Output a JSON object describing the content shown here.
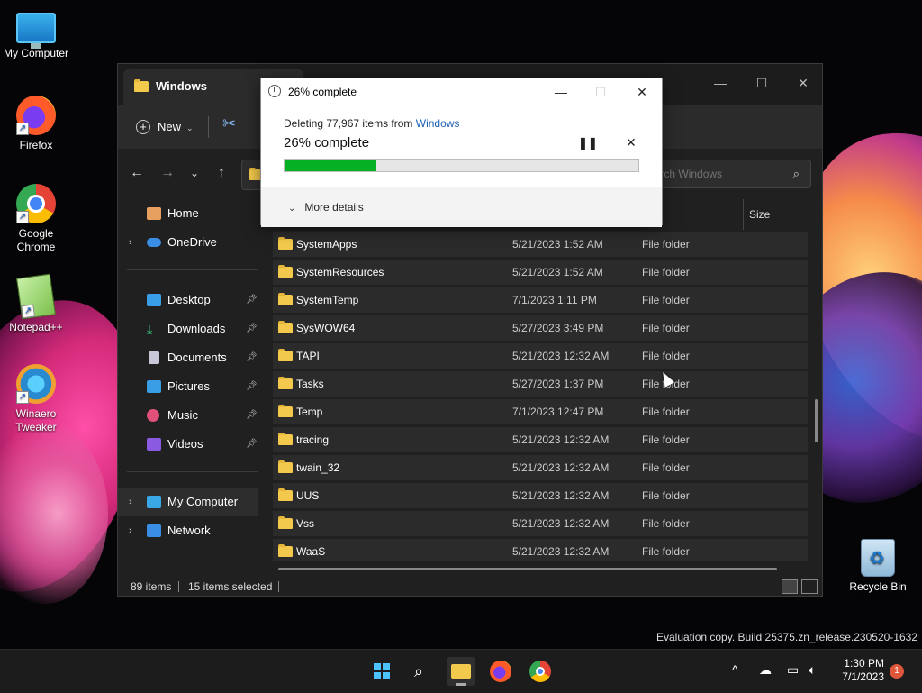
{
  "desktop": {
    "icons": [
      {
        "label": "My Computer"
      },
      {
        "label": "Firefox"
      },
      {
        "label": "Google Chrome"
      },
      {
        "label": "Notepad++"
      },
      {
        "label": "Winaero Tweaker"
      },
      {
        "label": "Recycle Bin"
      }
    ],
    "watermark": "Evaluation copy. Build 25375.zn_release.230520-1632"
  },
  "explorer": {
    "tab_title": "Windows",
    "toolbar": {
      "new_label": "New"
    },
    "search_placeholder": "Search Windows",
    "column_header_size": "Size",
    "sidebar": {
      "items": [
        {
          "label": "Home",
          "icon": "home-icon"
        },
        {
          "label": "OneDrive",
          "icon": "onedrive-icon"
        },
        {
          "label": "Desktop",
          "icon": "desktop-icon"
        },
        {
          "label": "Downloads",
          "icon": "downloads-icon"
        },
        {
          "label": "Documents",
          "icon": "documents-icon"
        },
        {
          "label": "Pictures",
          "icon": "pictures-icon"
        },
        {
          "label": "Music",
          "icon": "music-icon"
        },
        {
          "label": "Videos",
          "icon": "videos-icon"
        },
        {
          "label": "My Computer",
          "icon": "computer-icon"
        },
        {
          "label": "Network",
          "icon": "network-icon"
        }
      ]
    },
    "files": [
      {
        "name": "SystemApps",
        "date": "5/21/2023 1:52 AM",
        "type": "File folder"
      },
      {
        "name": "SystemResources",
        "date": "5/21/2023 1:52 AM",
        "type": "File folder"
      },
      {
        "name": "SystemTemp",
        "date": "7/1/2023 1:11 PM",
        "type": "File folder"
      },
      {
        "name": "SysWOW64",
        "date": "5/27/2023 3:49 PM",
        "type": "File folder"
      },
      {
        "name": "TAPI",
        "date": "5/21/2023 12:32 AM",
        "type": "File folder"
      },
      {
        "name": "Tasks",
        "date": "5/27/2023 1:37 PM",
        "type": "File folder"
      },
      {
        "name": "Temp",
        "date": "7/1/2023 12:47 PM",
        "type": "File folder"
      },
      {
        "name": "tracing",
        "date": "5/21/2023 12:32 AM",
        "type": "File folder"
      },
      {
        "name": "twain_32",
        "date": "5/21/2023 12:32 AM",
        "type": "File folder"
      },
      {
        "name": "UUS",
        "date": "5/21/2023 12:32 AM",
        "type": "File folder"
      },
      {
        "name": "Vss",
        "date": "5/21/2023 12:32 AM",
        "type": "File folder"
      },
      {
        "name": "WaaS",
        "date": "5/21/2023 12:32 AM",
        "type": "File folder"
      }
    ],
    "status": {
      "items": "89 items",
      "selected": "15 items selected"
    }
  },
  "progress_dialog": {
    "title": "26% complete",
    "deleting_prefix": "Deleting 77,967 items from",
    "deleting_location": "Windows",
    "percent_text": "26% complete",
    "percent": 26,
    "more_details": "More details",
    "fill_color": "#06b025"
  },
  "taskbar": {
    "time": "1:30 PM",
    "date": "7/1/2023",
    "notification_count": "1"
  }
}
